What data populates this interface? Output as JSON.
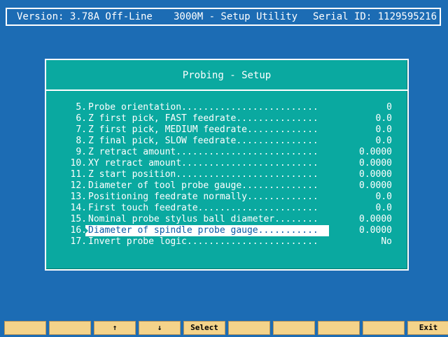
{
  "header": {
    "version": "Version: 3.78A Off-Line",
    "title": "3000M - Setup Utility",
    "serial": "Serial ID: 1129595216"
  },
  "panel": {
    "title": "Probing - Setup",
    "rows": [
      {
        "num": "5.",
        "label": "Probe orientation.........................",
        "value": "0"
      },
      {
        "num": "6.",
        "label": "Z first pick, FAST feedrate...............",
        "value": "0.0"
      },
      {
        "num": "7.",
        "label": "Z first pick, MEDIUM feedrate.............",
        "value": "0.0"
      },
      {
        "num": "8.",
        "label": "Z final pick, SLOW feedrate...............",
        "value": "0.0"
      },
      {
        "num": "9.",
        "label": "Z retract amount..........................",
        "value": "0.0000"
      },
      {
        "num": "10.",
        "label": "XY retract amount.........................",
        "value": "0.0000"
      },
      {
        "num": "11.",
        "label": "Z start position..........................",
        "value": "0.0000"
      },
      {
        "num": "12.",
        "label": "Diameter of tool probe gauge..............",
        "value": "0.0000"
      },
      {
        "num": "13.",
        "label": "Positioning feedrate normally.............",
        "value": "0.0"
      },
      {
        "num": "14.",
        "label": "First touch feedrate......................",
        "value": "0.0"
      },
      {
        "num": "15.",
        "label": "Nominal probe stylus ball diameter........",
        "value": "0.0000"
      },
      {
        "num": "16.",
        "label": "Diameter of spindle probe gauge...........",
        "value": "0.0000",
        "selected": true
      },
      {
        "num": "17.",
        "label": "Invert probe logic........................",
        "value": "No"
      }
    ]
  },
  "function_keys": [
    "",
    "",
    "↑",
    "↓",
    "Select",
    "",
    "",
    "",
    "",
    "Exit"
  ],
  "colors": {
    "background": "#1c6cb4",
    "panel": "#0aa9a0",
    "function_key": "#f4d38a",
    "selection_text": "#0a5aa8"
  }
}
